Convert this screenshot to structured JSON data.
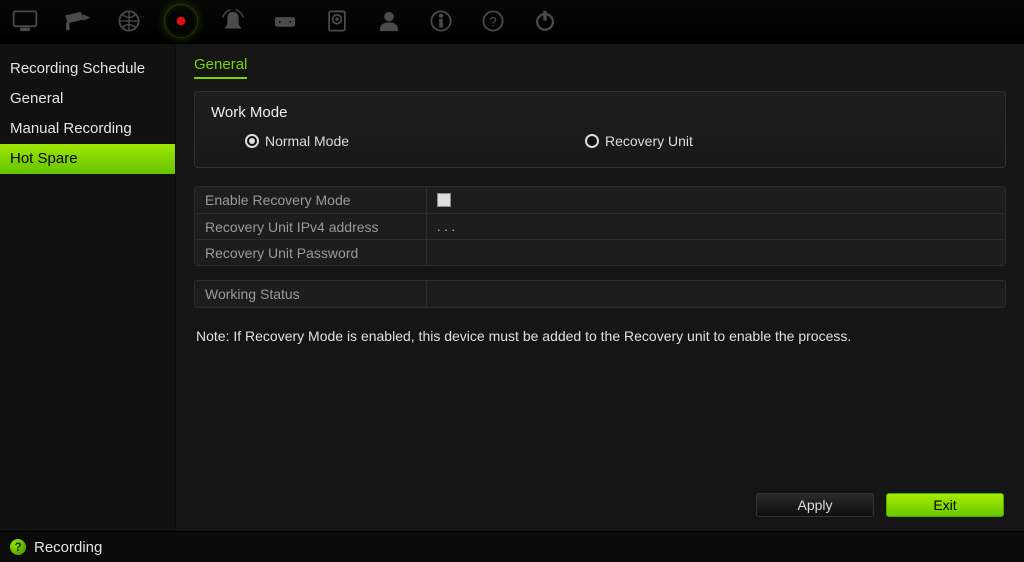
{
  "toolbar_icons": [
    "monitor-icon",
    "camera-icon",
    "globe-icon",
    "record-icon",
    "alarm-icon",
    "device-icon",
    "hdd-icon",
    "user-icon",
    "info-icon",
    "help-icon",
    "power-icon"
  ],
  "sidebar": {
    "items": [
      {
        "label": "Recording Schedule"
      },
      {
        "label": "General"
      },
      {
        "label": "Manual Recording"
      },
      {
        "label": "Hot Spare"
      }
    ],
    "active_index": 3
  },
  "tabs": {
    "items": [
      {
        "label": "General"
      }
    ],
    "active_index": 0
  },
  "work_mode": {
    "title": "Work Mode",
    "options": [
      {
        "label": "Normal Mode",
        "checked": true
      },
      {
        "label": "Recovery Unit",
        "checked": false
      }
    ]
  },
  "settings": {
    "rows": [
      {
        "label": "Enable Recovery Mode",
        "type": "checkbox",
        "checked": false
      },
      {
        "label": "Recovery Unit IPv4 address",
        "type": "text",
        "value": " .     .     ."
      },
      {
        "label": "Recovery Unit Password",
        "type": "text",
        "value": ""
      }
    ]
  },
  "status_row": {
    "label": "Working Status",
    "value": ""
  },
  "note": "Note: If Recovery Mode is enabled, this device must be added to the Recovery unit to enable the process.",
  "buttons": {
    "apply": "Apply",
    "exit": "Exit"
  },
  "statusbar": {
    "text": "Recording"
  },
  "colors": {
    "accent": "#79d400"
  }
}
